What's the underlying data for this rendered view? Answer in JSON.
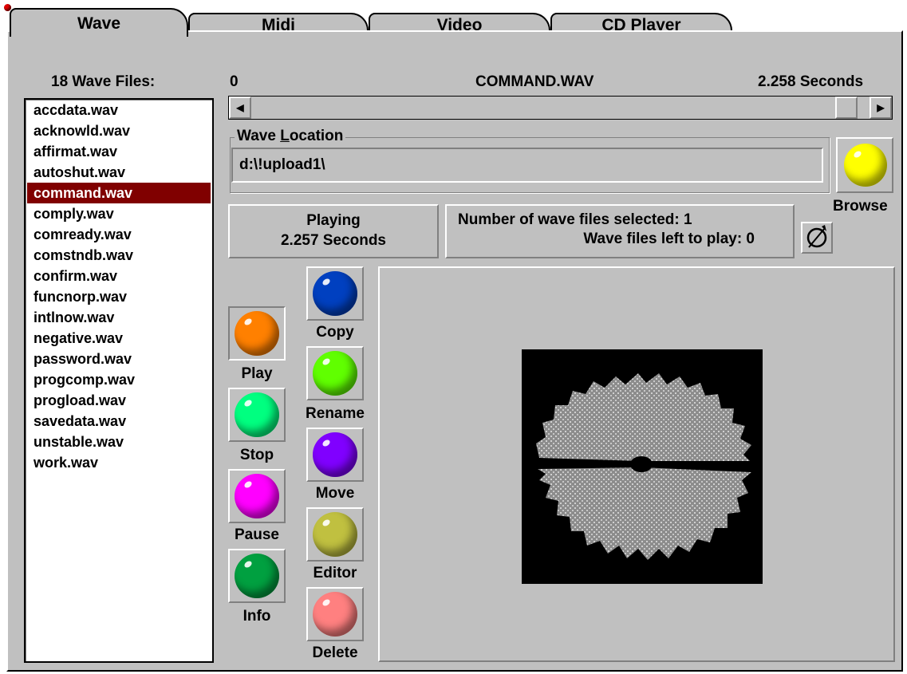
{
  "tabs": [
    {
      "label": "Wave"
    },
    {
      "label": "Midi"
    },
    {
      "label": "Video"
    },
    {
      "label": "CD Player"
    }
  ],
  "file_list": {
    "header": "18 Wave Files:",
    "items": [
      "accdata.wav",
      "acknowld.wav",
      "affirmat.wav",
      "autoshut.wav",
      "command.wav",
      "comply.wav",
      "comready.wav",
      "comstndb.wav",
      "confirm.wav",
      "funcnorp.wav",
      "intlnow.wav",
      "negative.wav",
      "password.wav",
      "progcomp.wav",
      "progload.wav",
      "savedata.wav",
      "unstable.wav",
      "work.wav"
    ],
    "selected": "command.wav",
    "selected_color": "#800000"
  },
  "position": {
    "start": "0",
    "filename": "COMMAND.WAV",
    "duration": "2.258 Seconds",
    "slider_fraction": 0.98
  },
  "location": {
    "label": "Wave Location",
    "value": "d:\\!upload1\\"
  },
  "status": {
    "line1": "Playing",
    "line2": "2.257 Seconds"
  },
  "selection_info": {
    "line1": "Number of wave files selected: 1",
    "line2": "Wave files left to play: 0"
  },
  "buttons": {
    "browse": {
      "label": "Browse",
      "color": "#ffff00"
    },
    "play": {
      "label": "Play",
      "color": "#ff8000"
    },
    "stop": {
      "label": "Stop",
      "color": "#00ff80"
    },
    "pause": {
      "label": "Pause",
      "color": "#ff00ff"
    },
    "info": {
      "label": "Info",
      "color": "#00a040"
    },
    "copy": {
      "label": "Copy",
      "color": "#0040c0"
    },
    "rename": {
      "label": "Rename",
      "color": "#60ff00"
    },
    "move": {
      "label": "Move",
      "color": "#8000ff"
    },
    "editor": {
      "label": "Editor",
      "color": "#c0c040"
    },
    "delete": {
      "label": "Delete",
      "color": "#ff8080"
    }
  },
  "icons": {
    "loop": "loop-arrow-icon",
    "saw": "saw-blade-wave-icon"
  }
}
